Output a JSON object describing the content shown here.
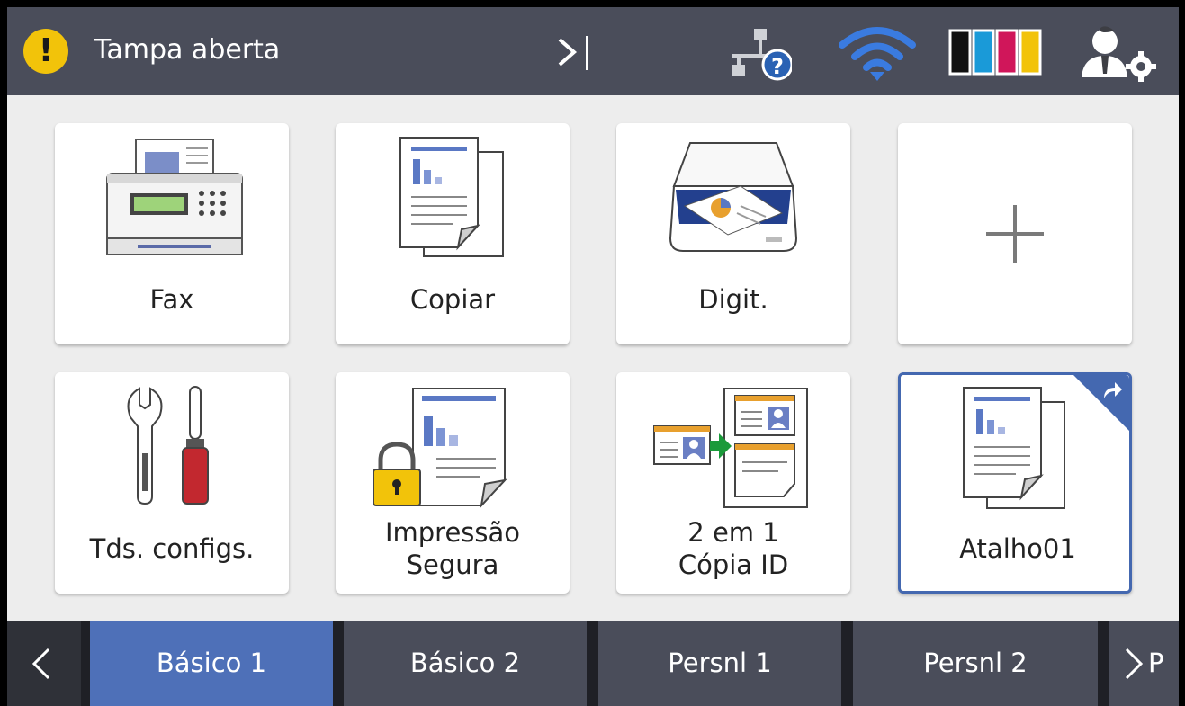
{
  "status": {
    "warning_glyph": "!",
    "message": "Tampa aberta",
    "icons": [
      "chevron-right-icon",
      "network-help-icon",
      "wifi-icon",
      "ink-levels-icon",
      "admin-settings-icon"
    ],
    "ink_colors": [
      "#111111",
      "#1a9ad8",
      "#d0165a",
      "#f2c30a"
    ]
  },
  "tiles": [
    {
      "label": "Fax",
      "icon": "fax-icon"
    },
    {
      "label": "Copiar",
      "icon": "copy-icon"
    },
    {
      "label": "Digit.",
      "icon": "scanner-icon"
    },
    {
      "label": "",
      "icon": "plus-icon"
    },
    {
      "label": "Tds. configs.",
      "icon": "tools-icon"
    },
    {
      "label_line1": "Impressão",
      "label_line2": "Segura",
      "icon": "secure-print-icon"
    },
    {
      "label_line1": "2 em 1",
      "label_line2": "Cópia ID",
      "icon": "id-copy-icon"
    },
    {
      "label": "Atalho01",
      "icon": "shortcut-icon"
    }
  ],
  "tabs": [
    {
      "label": "Básico 1",
      "active": true
    },
    {
      "label": "Básico 2"
    },
    {
      "label": "Persnl 1"
    },
    {
      "label": "Persnl 2"
    },
    {
      "label": "P"
    }
  ],
  "colors": {
    "accent": "#4e70b8",
    "statusbar": "#4a4d5a",
    "warning": "#f2c30a"
  }
}
